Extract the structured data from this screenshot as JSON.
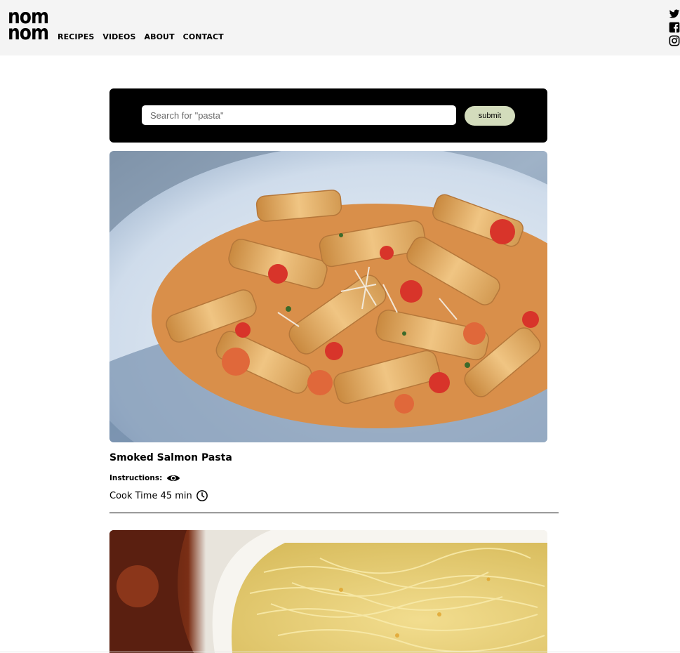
{
  "header": {
    "logo_line1": "nom",
    "logo_line2": "nom",
    "nav": [
      "RECIPES",
      "VIDEOS",
      "ABOUT",
      "CONTACT"
    ],
    "socials": [
      "twitter-icon",
      "facebook-icon",
      "instagram-icon"
    ]
  },
  "search": {
    "placeholder": "Search for \"pasta\"",
    "value": "",
    "submit_label": "submit"
  },
  "recipes": [
    {
      "title": "Smoked Salmon Pasta",
      "instructions_label": "Instructions:",
      "instructions_icon": "eye-icon",
      "cook_time_label": "Cook Time 45 min",
      "cook_time_icon": "clock-icon",
      "image": "penne-pasta-photo"
    },
    {
      "image": "noodle-soup-photo"
    }
  ],
  "colors": {
    "header_bg": "#f4f4f4",
    "search_panel_bg": "#000000",
    "submit_bg": "#d3dcbc"
  }
}
